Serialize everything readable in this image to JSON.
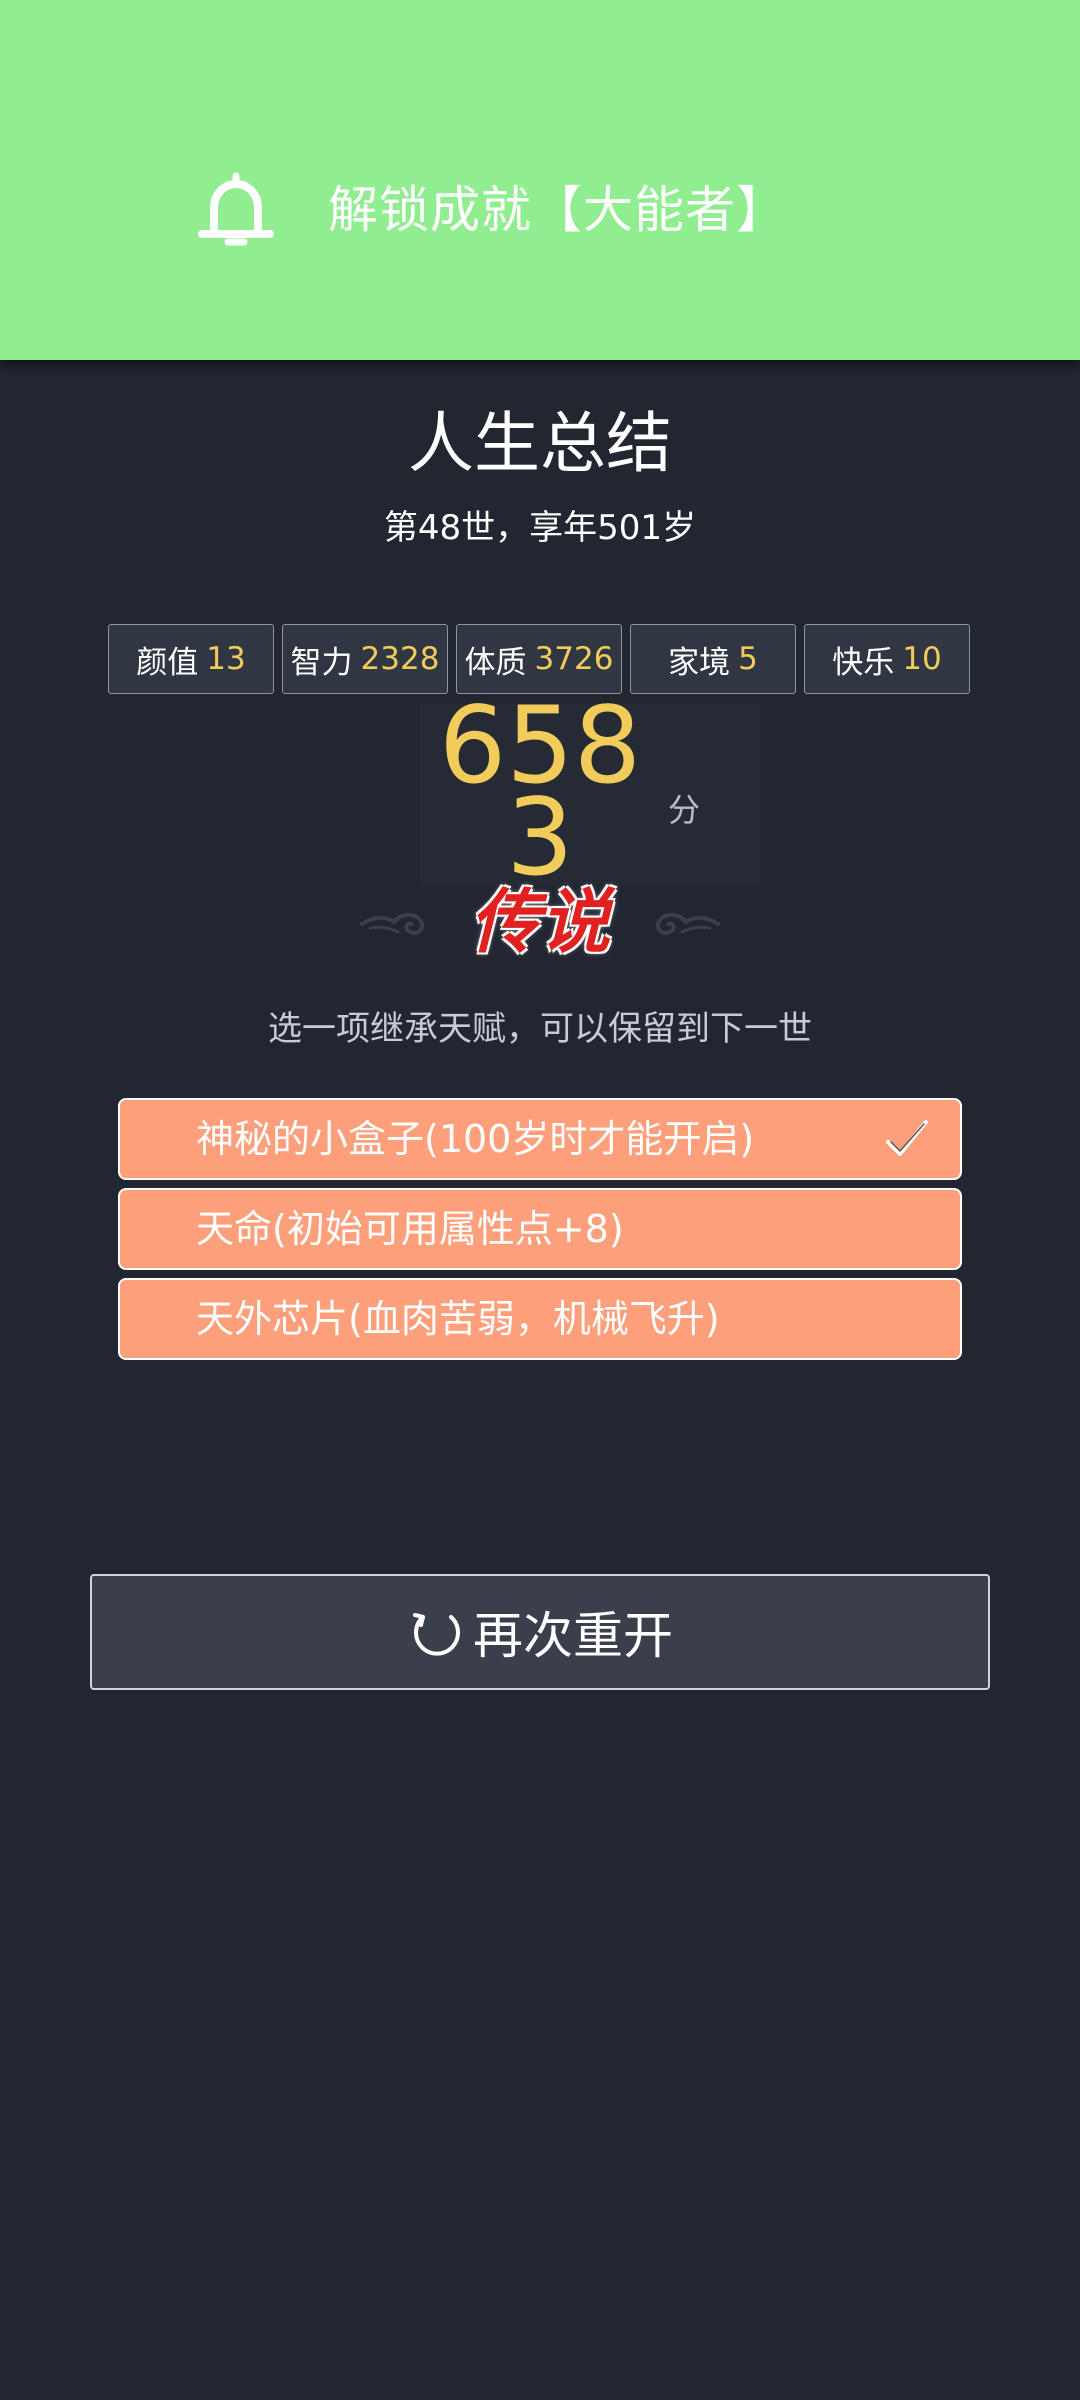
{
  "banner": {
    "icon": "bell-icon",
    "text": "解锁成就【大能者】",
    "color": "#90ee90"
  },
  "summary": {
    "title": "人生总结",
    "subtitle": "第48世，享年501岁"
  },
  "stats": [
    {
      "label": "颜值",
      "value": "13"
    },
    {
      "label": "智力",
      "value": "2328"
    },
    {
      "label": "体质",
      "value": "3726"
    },
    {
      "label": "家境",
      "value": "5"
    },
    {
      "label": "快乐",
      "value": "10"
    }
  ],
  "score": {
    "value": "6583",
    "unit": "分",
    "grade": "传说",
    "grade_color": "#e0211f"
  },
  "inherit": {
    "prompt": "选一项继承天赋，可以保留到下一世",
    "options": [
      {
        "text": "神秘的小盒子(100岁时才能开启)",
        "selected": true
      },
      {
        "text": "天命(初始可用属性点+8)",
        "selected": false
      },
      {
        "text": "天外芯片(血肉苦弱，机械飞升)",
        "selected": false
      }
    ],
    "option_color": "#fe9f7b"
  },
  "restart": {
    "icon": "refresh-icon",
    "label": "再次重开"
  },
  "colors": {
    "background": "#222631",
    "accent_value": "#f2cc5b"
  }
}
